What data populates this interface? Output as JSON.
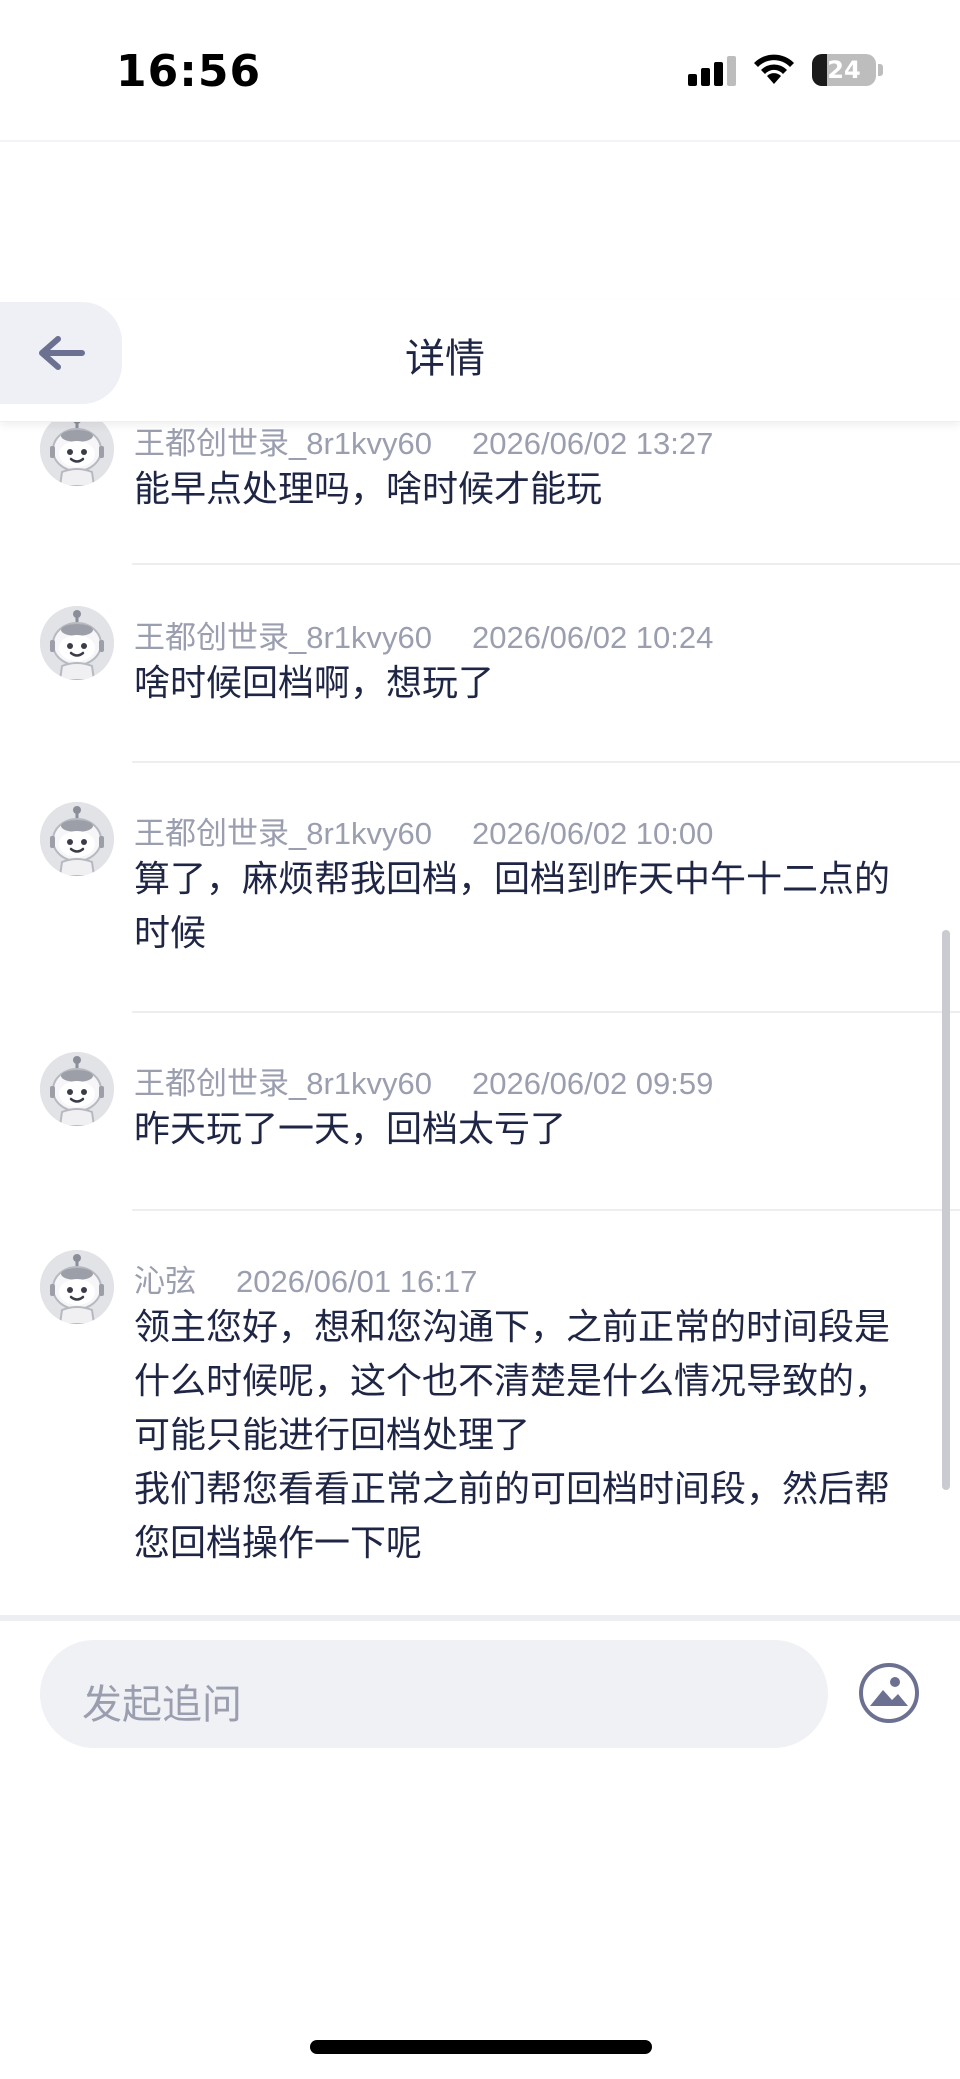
{
  "status_bar": {
    "time": "16:56",
    "battery": "24",
    "battery_level": 0.24
  },
  "header": {
    "title": "详情"
  },
  "messages": [
    {
      "author": "王都创世录_8r1kvy60",
      "time": "2026/06/02 13:27",
      "text": "能早点处理吗，啥时候才能玩"
    },
    {
      "author": "王都创世录_8r1kvy60",
      "time": "2026/06/02 10:24",
      "text": "啥时候回档啊，想玩了"
    },
    {
      "author": "王都创世录_8r1kvy60",
      "time": "2026/06/02 10:00",
      "text": "算了，麻烦帮我回档，回档到昨天中午十二点的时候"
    },
    {
      "author": "王都创世录_8r1kvy60",
      "time": "2026/06/02 09:59",
      "text": "昨天玩了一天，回档太亏了"
    },
    {
      "author": "沁弦",
      "time": "2026/06/01 16:17",
      "text_lines": [
        "领主您好，想和您沟通下，之前正常的时间段是什么时候呢，这个也不清楚是什么情况导致的，可能只能进行回档处理了",
        "我们帮您看看正常之前的可回档时间段，然后帮您回档操作一下呢"
      ]
    }
  ],
  "input": {
    "placeholder": "发起追问"
  },
  "icons": {
    "back": "arrow-left-icon",
    "image": "image-upload-icon",
    "avatar": "robot-avatar-icon"
  },
  "colors": {
    "text": "#1f2544",
    "meta": "#9a9eaf",
    "input_bg": "#f0f1f5",
    "back_bg": "#eef0f5"
  }
}
